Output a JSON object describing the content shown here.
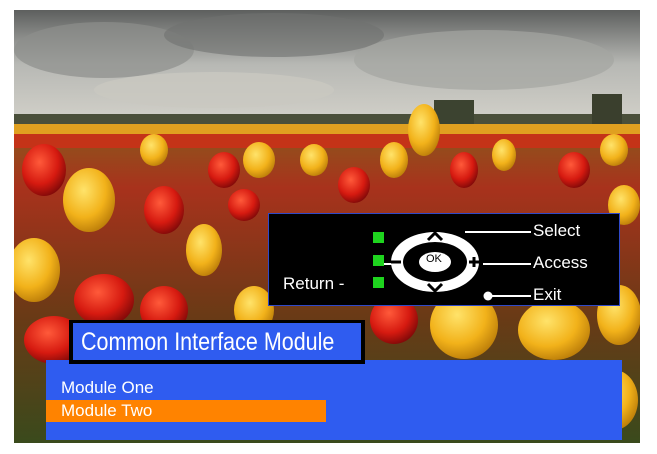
{
  "key_guide": {
    "select_label": "Select",
    "access_label": "Access",
    "exit_label": "Exit",
    "return_label": "Return -",
    "ok_label": "OK"
  },
  "title": "Common Interface Module",
  "modules": [
    {
      "label": "Module One",
      "selected": false
    },
    {
      "label": "Module Two",
      "selected": true
    }
  ],
  "colors": {
    "panel_blue": "#2f5cf0",
    "highlight_orange": "#ff8300",
    "guide_green": "#1ed41e"
  }
}
